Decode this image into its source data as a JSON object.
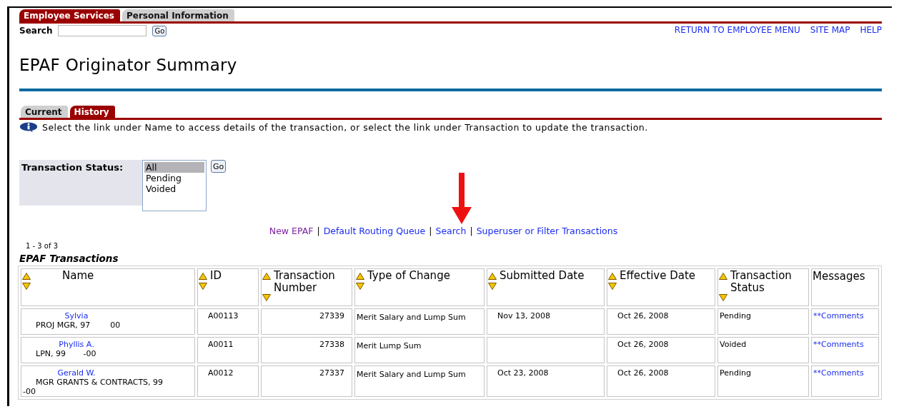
{
  "top_tabs": [
    {
      "label": "Employee Services",
      "selected": true
    },
    {
      "label": "Personal Information",
      "selected": false
    }
  ],
  "search": {
    "label": "Search",
    "button": "Go"
  },
  "top_links": [
    "RETURN TO EMPLOYEE MENU",
    "SITE MAP",
    "HELP"
  ],
  "page_title": "EPAF Originator Summary",
  "sub_tabs": [
    {
      "label": "Current",
      "selected": false
    },
    {
      "label": "History",
      "selected": true
    }
  ],
  "info_text": "Select the link under Name to access details of the transaction, or select the link under Transaction to update the transaction.",
  "status_filter": {
    "label": "Transaction Status:",
    "button": "Go",
    "options": [
      {
        "label": "All",
        "selected": true
      },
      {
        "label": "Pending",
        "selected": false
      },
      {
        "label": "Voided",
        "selected": false
      }
    ]
  },
  "action_links": [
    {
      "label": "New EPAF",
      "visited": true
    },
    {
      "label": "Default Routing Queue",
      "visited": false,
      "separator": "|"
    },
    {
      "label": "Search",
      "visited": false,
      "separator": "|"
    },
    {
      "label": "Superuser or Filter Transactions",
      "visited": false,
      "separator": "|"
    }
  ],
  "record_count": "1 - 3 of 3",
  "table": {
    "title": "EPAF Transactions",
    "columns": [
      {
        "label": "Name",
        "sortable": true
      },
      {
        "label": "ID",
        "sortable": true
      },
      {
        "label": "Transaction Number",
        "sortable": true
      },
      {
        "label": "Type of Change",
        "sortable": true
      },
      {
        "label": "Submitted Date",
        "sortable": true
      },
      {
        "label": "Effective Date",
        "sortable": true
      },
      {
        "label": "Transaction Status",
        "sortable": true
      },
      {
        "label": "Messages",
        "sortable": false
      }
    ],
    "rows": [
      {
        "name": "Sylvia",
        "position": "PROJ MGR, 97        00",
        "id": "A00113",
        "number": "27339",
        "type": "Merit Salary and Lump Sum",
        "submitted": "Nov 13, 2008",
        "effective": "Oct 26, 2008",
        "status": "Pending",
        "messages": "**Comments"
      },
      {
        "name": "Phyllis A.",
        "position": "LPN, 99       -00",
        "id": "A0011",
        "number": "27338",
        "type": "Merit Lump Sum",
        "effective": "Oct 26, 2008",
        "status": "Voided",
        "messages": "**Comments"
      },
      {
        "name": "Gerald W.",
        "position": "MGR GRANTS & CONTRACTS, 99       -00",
        "id": "A0012",
        "number": "27337",
        "type": "Merit Salary and Lump Sum",
        "submitted": "Oct 23, 2008",
        "effective": "Oct 26, 2008",
        "status": "Pending",
        "messages": "**Comments"
      }
    ]
  }
}
